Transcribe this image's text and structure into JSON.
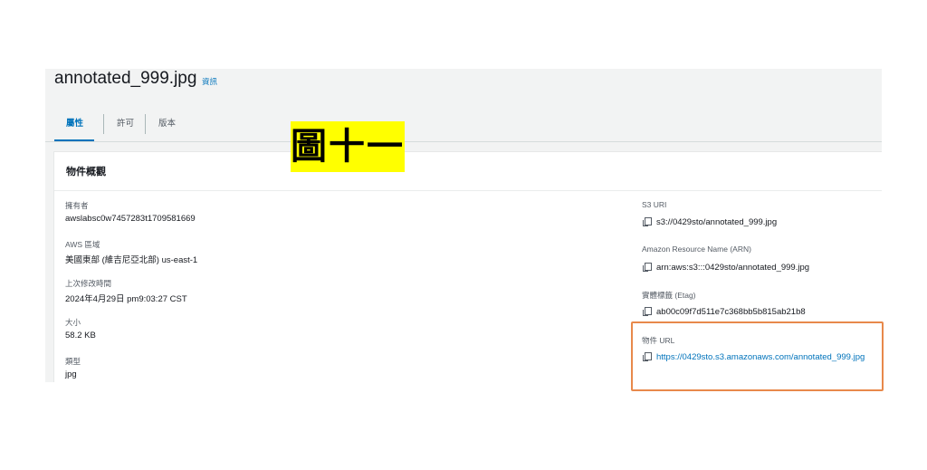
{
  "header": {
    "title": "annotated_999.jpg",
    "info_link": "資訊"
  },
  "tabs": [
    {
      "label": "屬性",
      "active": true
    },
    {
      "label": "許可",
      "active": false
    },
    {
      "label": "版本",
      "active": false
    }
  ],
  "annotation": {
    "label": "圖十一",
    "background": "#ffff00",
    "highlight_color": "#e8894b"
  },
  "overview": {
    "title": "物件概觀",
    "left_fields": [
      {
        "label": "擁有者",
        "value": "awslabsc0w7457283t1709581669"
      },
      {
        "label": "AWS 區域",
        "value": "美國東部 (維吉尼亞北部) us-east-1"
      },
      {
        "label": "上次修改時間",
        "value": "2024年4月29日 pm9:03:27 CST"
      },
      {
        "label": "大小",
        "value": "58.2 KB"
      },
      {
        "label": "類型",
        "value": "jpg"
      }
    ],
    "right_fields": [
      {
        "label": "S3 URI",
        "value": "s3://0429sto/annotated_999.jpg",
        "icon": "copy-icon"
      },
      {
        "label": "Amazon Resource Name (ARN)",
        "value": "arn:aws:s3:::0429sto/annotated_999.jpg",
        "icon": "copy-icon"
      },
      {
        "label": "實體標籤 (Etag)",
        "value": "ab00c09f7d511e7c368bb5b815ab21b8",
        "icon": "copy-icon"
      },
      {
        "label": "物件 URL",
        "value": "https://0429sto.s3.amazonaws.com/annotated_999.jpg",
        "icon": "copy-icon",
        "link": true
      }
    ]
  },
  "colors": {
    "accent": "#0073bb",
    "panel_bg": "#f2f3f3",
    "text": "#16191f",
    "muted": "#545b64"
  }
}
